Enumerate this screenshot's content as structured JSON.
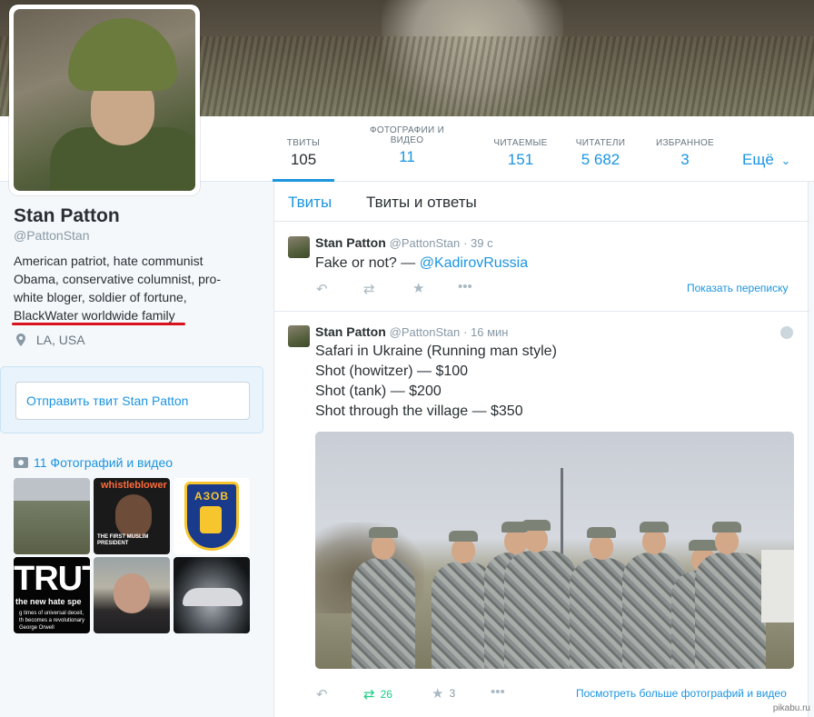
{
  "profile": {
    "name": "Stan Patton",
    "handle": "@PattonStan",
    "bio": "American patriot, hate communist Obama, conservative columnist, pro-white bloger, soldier of fortune, BlackWater worldwide family",
    "location": "LA, USA",
    "tweet_to_button": "Отправить твит Stan Patton"
  },
  "stats": [
    {
      "label": "ТВИТЫ",
      "value": "105",
      "active": true
    },
    {
      "label": "ФОТОГРАФИИ И ВИДЕО",
      "value": "11",
      "active": false
    },
    {
      "label": "ЧИТАЕМЫЕ",
      "value": "151",
      "active": false
    },
    {
      "label": "ЧИТАТЕЛИ",
      "value": "5 682",
      "active": false
    },
    {
      "label": "ИЗБРАННОЕ",
      "value": "3",
      "active": false
    }
  ],
  "more_label": "Ещё",
  "photos": {
    "header": "11 Фотографий и видео",
    "thumb_whistleblower": "whistleblower",
    "thumb_obama_caption": "THE FIRST MUSLIM PRESIDENT",
    "thumb_azov": "АЗОВ",
    "thumb_truth_big": "TRUTH",
    "thumb_truth_sub": "the new hate spe",
    "thumb_truth_small": "g times of universal deceit, th becomes a revolutionary George Orwell"
  },
  "tabs": [
    {
      "label": "Твиты",
      "active": true
    },
    {
      "label": "Твиты и ответы",
      "active": false
    }
  ],
  "tweets": [
    {
      "name": "Stan Patton",
      "handle": "@PattonStan",
      "time": "· 39 с",
      "text_before": "Fake or not? — ",
      "mention": "@KadirovRussia",
      "conversation_link": "Показать переписку"
    },
    {
      "name": "Stan Patton",
      "handle": "@PattonStan",
      "time": "· 16 мин",
      "lines": [
        "Safari in Ukraine (Running man style)",
        "Shot (howitzer) — $100",
        "Shot (tank) — $200",
        "Shot through the village — $350"
      ],
      "retweets": "26",
      "favorites": "3",
      "more_media_link": "Посмотреть больше фотографий и видео"
    }
  ],
  "watermark": "pikabu.ru",
  "colors": {
    "accent": "#1b95e0",
    "retweet_active": "#19cf86",
    "underline": "#d9111b"
  }
}
